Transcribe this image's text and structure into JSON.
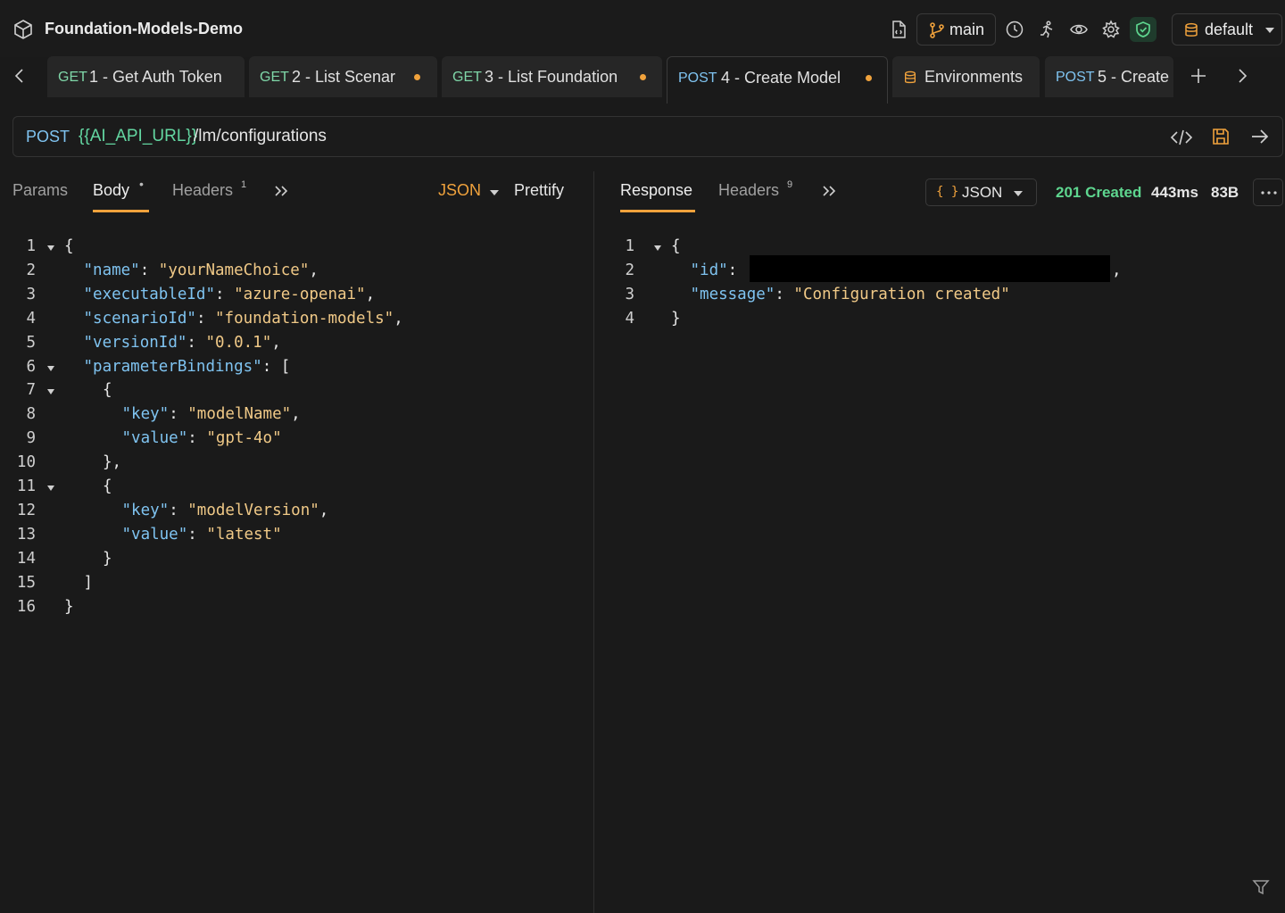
{
  "app": {
    "title": "Foundation-Models-Demo",
    "icon": "cube-icon"
  },
  "toolbar": {
    "branch_label": "main",
    "environment_label": "default",
    "icons": [
      "file-icon",
      "branch-icon",
      "history-icon",
      "runner-icon",
      "eye-icon",
      "gear-icon",
      "shield-check-icon",
      "database-icon"
    ]
  },
  "tabs": [
    {
      "method": "GET",
      "title": "1 - Get Auth Token",
      "unsaved": false
    },
    {
      "method": "GET",
      "title": "2 - List Scenar",
      "unsaved": true
    },
    {
      "method": "GET",
      "title": "3 - List Foundation",
      "unsaved": true
    },
    {
      "method": "POST",
      "title": "4 - Create Model",
      "unsaved": true,
      "active": true
    },
    {
      "method": "",
      "title": "Environments",
      "icon": "database-icon"
    },
    {
      "method": "POST",
      "title": "5 - Create"
    }
  ],
  "request": {
    "method": "POST",
    "url_variable": "{{AI_API_URL}}",
    "url_path": "/lm/configurations"
  },
  "request_tabs": {
    "params": "Params",
    "body": "Body",
    "body_marker": "•",
    "headers": "Headers",
    "headers_count": "1",
    "format": "JSON",
    "prettify": "Prettify"
  },
  "body_lines": [
    {
      "n": "1",
      "fold": true,
      "parts": [
        [
          "p",
          "{"
        ]
      ]
    },
    {
      "n": "2",
      "indent": 1,
      "parts": [
        [
          "k",
          "\"name\""
        ],
        [
          "p",
          ": "
        ],
        [
          "s",
          "\"yourNameChoice\""
        ],
        [
          "p",
          ","
        ]
      ]
    },
    {
      "n": "3",
      "indent": 1,
      "parts": [
        [
          "k",
          "\"executableId\""
        ],
        [
          "p",
          ": "
        ],
        [
          "s",
          "\"azure-openai\""
        ],
        [
          "p",
          ","
        ]
      ]
    },
    {
      "n": "4",
      "indent": 1,
      "parts": [
        [
          "k",
          "\"scenarioId\""
        ],
        [
          "p",
          ": "
        ],
        [
          "s",
          "\"foundation-models\""
        ],
        [
          "p",
          ","
        ]
      ]
    },
    {
      "n": "5",
      "indent": 1,
      "parts": [
        [
          "k",
          "\"versionId\""
        ],
        [
          "p",
          ": "
        ],
        [
          "s",
          "\"0.0.1\""
        ],
        [
          "p",
          ","
        ]
      ]
    },
    {
      "n": "6",
      "fold": true,
      "indent": 1,
      "parts": [
        [
          "k",
          "\"parameterBindings\""
        ],
        [
          "p",
          ": ["
        ]
      ]
    },
    {
      "n": "7",
      "fold": true,
      "indent": 2,
      "parts": [
        [
          "p",
          "{"
        ]
      ]
    },
    {
      "n": "8",
      "indent": 3,
      "parts": [
        [
          "k",
          "\"key\""
        ],
        [
          "p",
          ": "
        ],
        [
          "s",
          "\"modelName\""
        ],
        [
          "p",
          ","
        ]
      ]
    },
    {
      "n": "9",
      "indent": 3,
      "parts": [
        [
          "k",
          "\"value\""
        ],
        [
          "p",
          ": "
        ],
        [
          "s",
          "\"gpt-4o\""
        ]
      ]
    },
    {
      "n": "10",
      "indent": 2,
      "parts": [
        [
          "p",
          "},"
        ]
      ]
    },
    {
      "n": "11",
      "fold": true,
      "indent": 2,
      "parts": [
        [
          "p",
          "{"
        ]
      ]
    },
    {
      "n": "12",
      "indent": 3,
      "parts": [
        [
          "k",
          "\"key\""
        ],
        [
          "p",
          ": "
        ],
        [
          "s",
          "\"modelVersion\""
        ],
        [
          "p",
          ","
        ]
      ]
    },
    {
      "n": "13",
      "indent": 3,
      "parts": [
        [
          "k",
          "\"value\""
        ],
        [
          "p",
          ": "
        ],
        [
          "s",
          "\"latest\""
        ]
      ]
    },
    {
      "n": "14",
      "indent": 2,
      "parts": [
        [
          "p",
          "}"
        ]
      ]
    },
    {
      "n": "15",
      "indent": 1,
      "parts": [
        [
          "p",
          "]"
        ]
      ]
    },
    {
      "n": "16",
      "indent": 0,
      "parts": [
        [
          "p",
          "}"
        ]
      ]
    }
  ],
  "response_tabs": {
    "response": "Response",
    "headers": "Headers",
    "headers_count": "9",
    "format_icon": "{ }",
    "format": "JSON",
    "status": "201 Created",
    "time": "443ms",
    "size": "83B",
    "status_color": "#5ed68f"
  },
  "response_lines": [
    {
      "n": "1",
      "fold": true,
      "parts": [
        [
          "p",
          "{"
        ]
      ]
    },
    {
      "n": "2",
      "indent": 1,
      "redacted": true,
      "parts": [
        [
          "k",
          "\"id\""
        ],
        [
          "p",
          ":"
        ]
      ],
      "tail": ","
    },
    {
      "n": "3",
      "indent": 1,
      "parts": [
        [
          "k",
          "\"message\""
        ],
        [
          "p",
          ": "
        ],
        [
          "s",
          "\"Configuration created\""
        ]
      ]
    },
    {
      "n": "4",
      "indent": 0,
      "parts": [
        [
          "p",
          "}"
        ]
      ]
    }
  ]
}
